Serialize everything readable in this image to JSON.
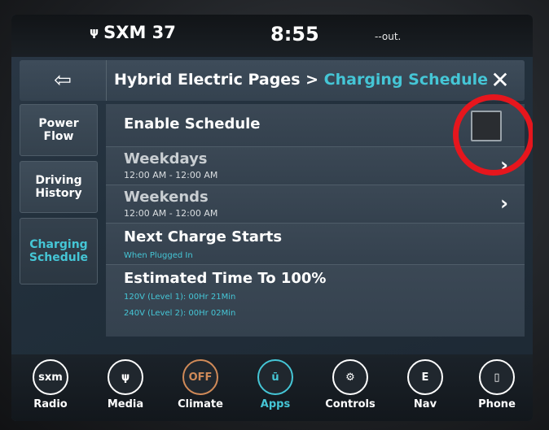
{
  "status": {
    "radio": "SXM 37",
    "time": "8:55",
    "outside_temp": "--out."
  },
  "header": {
    "breadcrumb_parent": "Hybrid Electric Pages > ",
    "breadcrumb_current": "Charging Schedule"
  },
  "sidebar": {
    "items": [
      {
        "label_line1": "Power",
        "label_line2": "Flow"
      },
      {
        "label_line1": "Driving",
        "label_line2": "History"
      },
      {
        "label_line1": "Charging",
        "label_line2": "Schedule"
      }
    ]
  },
  "rows": {
    "enable": {
      "label": "Enable Schedule",
      "checked": false
    },
    "weekdays": {
      "label": "Weekdays",
      "time": "12:00 AM - 12:00 AM"
    },
    "weekends": {
      "label": "Weekends",
      "time": "12:00 AM - 12:00 AM"
    },
    "next_charge": {
      "label": "Next Charge Starts",
      "value": "When Plugged In"
    },
    "estimate": {
      "label": "Estimated Time To 100%",
      "level1": "120V (Level 1): 00Hr 21Min",
      "level2": "240V (Level 2): 00Hr 02Min"
    }
  },
  "dock": {
    "items": [
      {
        "label": "Radio",
        "icon_text": "sxm"
      },
      {
        "label": "Media",
        "icon_text": "ψ"
      },
      {
        "label": "Climate",
        "icon_text": "OFF"
      },
      {
        "label": "Apps",
        "icon_text": "ū"
      },
      {
        "label": "Controls",
        "icon_text": "⚙"
      },
      {
        "label": "Nav",
        "icon_text": "E"
      },
      {
        "label": "Phone",
        "icon_text": "▯"
      }
    ]
  },
  "colors": {
    "accent": "#45c6d6",
    "highlight_ring": "#e6161d"
  }
}
